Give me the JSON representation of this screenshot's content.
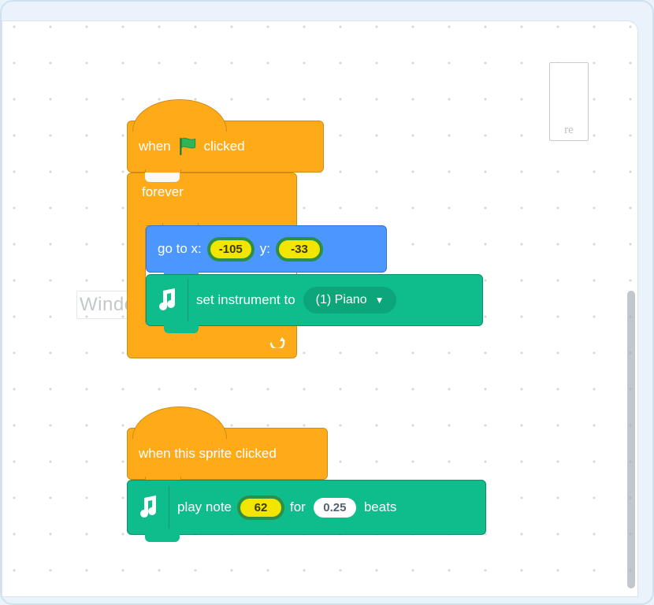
{
  "top_right_watermark": "re",
  "bg_watermark": "Window Snip",
  "script1": {
    "hat": {
      "prefix": "when",
      "suffix": "clicked"
    },
    "forever_label": "forever",
    "goto": {
      "label_x": "go to x:",
      "x": "-105",
      "label_y": "y:",
      "y": "-33"
    },
    "set_instrument": {
      "label": "set instrument to",
      "value": "(1) Piano"
    }
  },
  "script2": {
    "hat_label": "when this sprite clicked",
    "play_note": {
      "label1": "play note",
      "note": "62",
      "label2": "for",
      "beats": "0.25",
      "label3": "beats"
    }
  },
  "colors": {
    "event": "#ffab19",
    "motion": "#4c97ff",
    "music": "#0fbd8c",
    "input_yellow": "#f2e600"
  }
}
